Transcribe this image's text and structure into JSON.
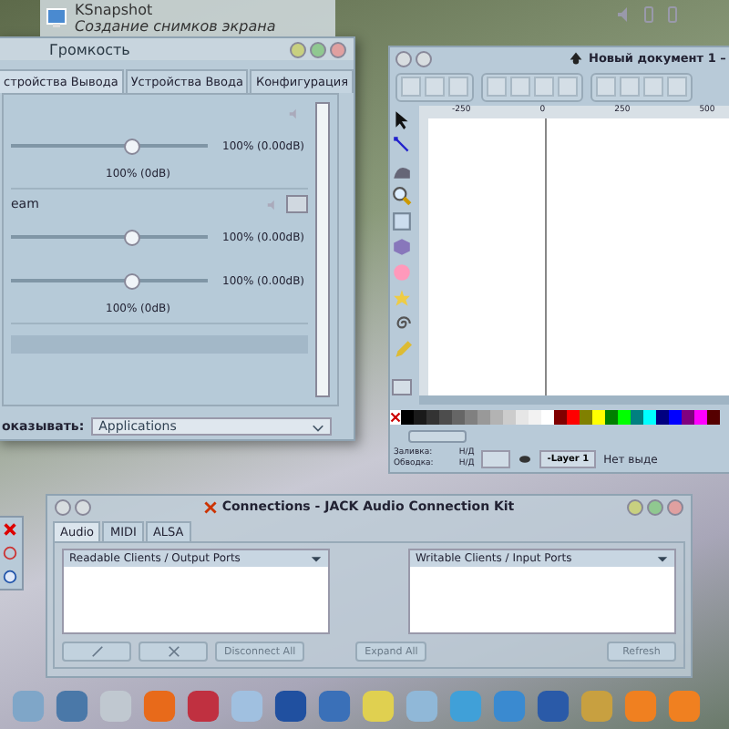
{
  "notification": {
    "title": "KSnapshot",
    "subtitle": "Создание снимков экрана"
  },
  "volume_window": {
    "title": "Громкость",
    "tabs": [
      {
        "label": "стройства Вывода",
        "selected": true
      },
      {
        "label": "Устройства Ввода",
        "selected": false
      },
      {
        "label": "Конфигурация",
        "selected": false
      }
    ],
    "channels": [
      {
        "sliders": [
          {
            "level": 0.6,
            "reading": "100% (0.00dB)"
          }
        ],
        "caption": "100% (0dB)"
      },
      {
        "name": "eam",
        "sliders": [
          {
            "level": 0.6,
            "reading": "100% (0.00dB)"
          },
          {
            "level": 0.6,
            "reading": "100% (0.00dB)"
          }
        ],
        "caption": "100% (0dB)"
      }
    ],
    "show_label": "оказывать:",
    "show_value": "Applications"
  },
  "inkscape": {
    "title": "Новый документ 1 –",
    "ruler": [
      "-250",
      "0",
      "250",
      "500"
    ],
    "palette": [
      {
        "color": "#000000"
      },
      {
        "color": "#1a1a1a"
      },
      {
        "color": "#333333"
      },
      {
        "color": "#4d4d4d"
      },
      {
        "color": "#666666"
      },
      {
        "color": "#808080"
      },
      {
        "color": "#999999"
      },
      {
        "color": "#b3b3b3"
      },
      {
        "color": "#cccccc"
      },
      {
        "color": "#e6e6e6"
      },
      {
        "color": "#f2f2f2"
      },
      {
        "color": "#ffffff"
      },
      {
        "color": "#800000"
      },
      {
        "color": "#ff0000"
      },
      {
        "color": "#808000"
      },
      {
        "color": "#ffff00"
      },
      {
        "color": "#008000"
      },
      {
        "color": "#00ff00"
      },
      {
        "color": "#008080"
      },
      {
        "color": "#00ffff"
      },
      {
        "color": "#000080"
      },
      {
        "color": "#0000ff"
      },
      {
        "color": "#800080"
      },
      {
        "color": "#ff00ff"
      },
      {
        "color": "#550000"
      }
    ],
    "fill_label": "Заливка:",
    "fill_value": "Н/Д",
    "stroke_label": "Обводка:",
    "stroke_value": "Н/Д",
    "layer": "-Layer 1",
    "status": "Нет выде"
  },
  "jack": {
    "title": "Connections - JACK Audio Connection Kit",
    "tabs": [
      {
        "label": "Audio",
        "selected": true
      },
      {
        "label": "MIDI",
        "selected": false
      },
      {
        "label": "ALSA",
        "selected": false
      }
    ],
    "left_header": "Readable Clients / Output Ports",
    "right_header": "Writable Clients / Input Ports",
    "buttons": [
      {
        "label": "Disconnect All",
        "disabled": true
      },
      {
        "label": "Expand All",
        "disabled": true
      },
      {
        "label": "Refresh",
        "disabled": true
      }
    ]
  }
}
